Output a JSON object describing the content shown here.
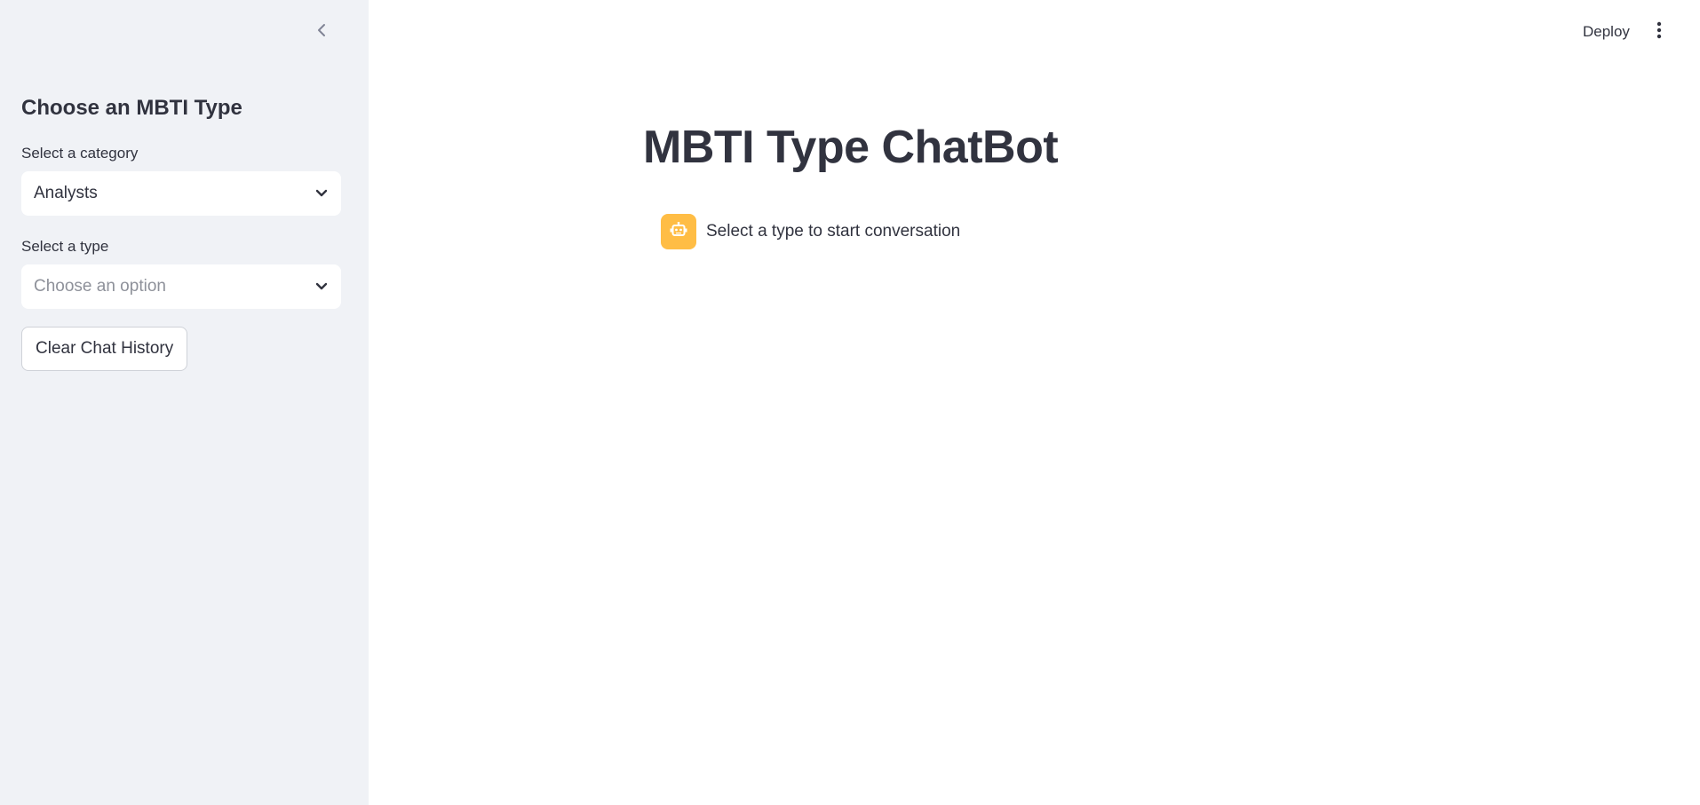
{
  "sidebar": {
    "collapse_icon": "chevron-left-icon",
    "heading": "Choose an MBTI Type",
    "category": {
      "label": "Select a category",
      "value": "Analysts",
      "icon": "chevron-down-icon"
    },
    "type": {
      "label": "Select a type",
      "placeholder": "Choose an option",
      "icon": "chevron-down-icon"
    },
    "clear_button_label": "Clear Chat History"
  },
  "header": {
    "deploy_label": "Deploy",
    "menu_icon": "more-vertical-icon"
  },
  "main": {
    "title": "MBTI Type ChatBot",
    "messages": [
      {
        "role": "assistant",
        "avatar_icon": "robot-icon",
        "avatar_color": "#ffbd45",
        "text": "Select a type to start conversation"
      }
    ]
  },
  "colors": {
    "sidebar_bg": "#f0f2f6",
    "text": "#31333f",
    "placeholder": "#8e919a",
    "avatar_bg": "#ffbd45"
  }
}
